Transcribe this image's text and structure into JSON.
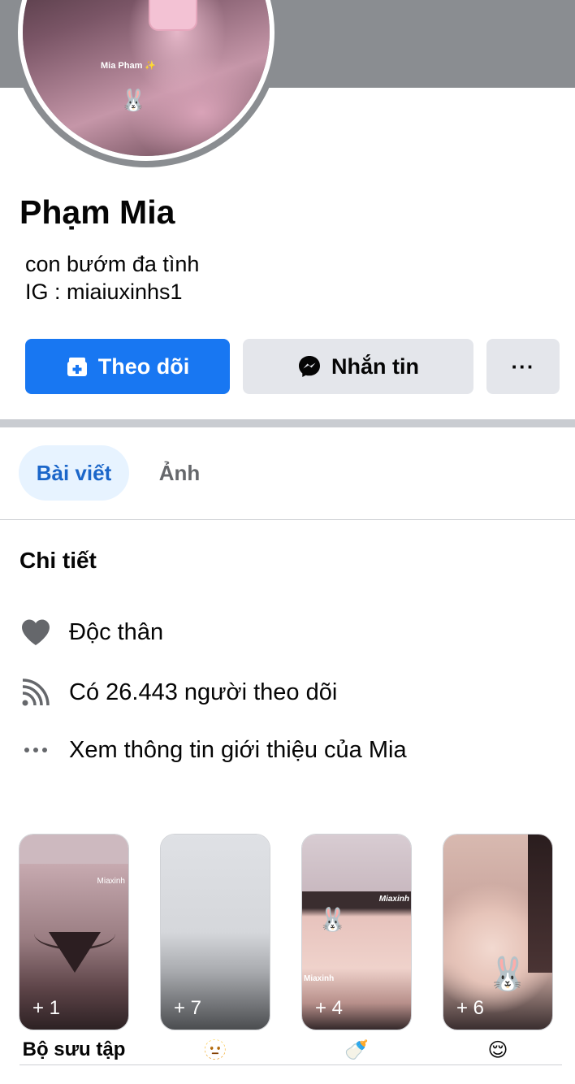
{
  "profile": {
    "name": "Phạm Mia",
    "bio_line1": "con bướm đa tình",
    "bio_line2": "IG : miaiuxinhs1",
    "avatar_caption": "Mia Pham ✨",
    "avatar_emoji": "🐰"
  },
  "actions": {
    "follow_label": "Theo dõi",
    "message_label": "Nhắn tin",
    "more_label": "···"
  },
  "tabs": [
    {
      "label": "Bài viết",
      "active": true
    },
    {
      "label": "Ảnh",
      "active": false
    }
  ],
  "details": {
    "title": "Chi tiết",
    "items": [
      {
        "icon": "heart-icon",
        "text": "Độc thân"
      },
      {
        "icon": "rss-icon",
        "text": "Có 26.443 người theo dõi"
      },
      {
        "icon": "ellipsis-icon",
        "text": "Xem thông tin giới thiệu của Mia"
      }
    ]
  },
  "highlights": [
    {
      "count": "+ 1",
      "caption": "Bộ sưu tập",
      "watermark": "Miaxinh"
    },
    {
      "count": "+ 7",
      "caption": "🫥"
    },
    {
      "count": "+ 4",
      "caption": "🍼",
      "watermark": "Miaxinh",
      "watermark2": "Miaxinh"
    },
    {
      "count": "+ 6",
      "caption": "😌"
    }
  ],
  "colors": {
    "accent": "#1877f2",
    "tab_active_bg": "#e7f3ff",
    "tab_active_text": "#1b66c9",
    "button_gray": "#e4e6eb",
    "cover_gray": "#8a8d91"
  }
}
